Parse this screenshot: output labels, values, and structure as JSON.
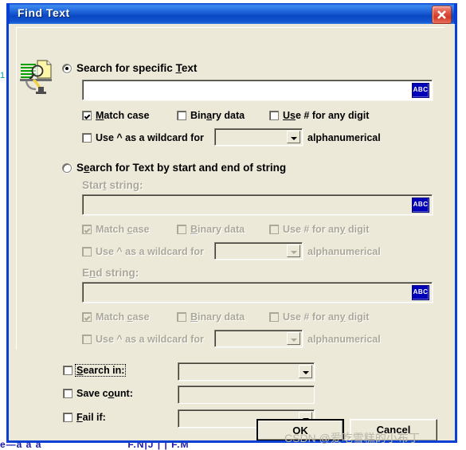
{
  "window": {
    "title": "Find Text",
    "close_icon": "close-icon"
  },
  "icon": {
    "name": "find-text-icon"
  },
  "specific": {
    "radio_label_pre": "Search for specific ",
    "radio_label_accel": "T",
    "radio_label_post": "ext",
    "radio_checked": true,
    "text_value": "",
    "abc_button_label": "ABC",
    "options": [
      {
        "pre": "",
        "accel": "M",
        "post": "atch case",
        "checked": true
      },
      {
        "pre": "Bin",
        "accel": "a",
        "post": "ry data",
        "checked": false
      },
      {
        "pre": "",
        "accel": "Us",
        "post": "e # for any digit",
        "checked": false
      }
    ],
    "wildcard": {
      "pre": "Use ^ as a wildcard for ",
      "checked": false,
      "combo_value": "",
      "suffix": "alphanumerical"
    }
  },
  "startend": {
    "radio_label_pre": "S",
    "radio_label_accel": "e",
    "radio_label_post": "arch for Text by start and end of string",
    "radio_checked": false,
    "start_label_pre": "Star",
    "start_label_accel": "t",
    "start_label_post": " string:",
    "start_value": "",
    "end_label_pre": "E",
    "end_label_accel": "n",
    "end_label_post": "d string:",
    "end_value": "",
    "abc_button_label": "ABC",
    "start_options": [
      {
        "pre": "Match ",
        "accel": "c",
        "post": "ase",
        "checked": true
      },
      {
        "pre": "",
        "accel": "B",
        "post": "inary data",
        "checked": false
      },
      {
        "pre": "Use # for an",
        "accel": "y",
        "post": " digit",
        "checked": false
      }
    ],
    "start_wildcard": {
      "pre": "Use ^ as a wildcard for ",
      "checked": false,
      "combo_value": "",
      "suffix": "alphanumerical"
    },
    "end_options": [
      {
        "pre": "Match ",
        "accel": "c",
        "post": "ase",
        "checked": true
      },
      {
        "pre": "",
        "accel": "B",
        "post": "inary data",
        "checked": false
      },
      {
        "pre": "Use # for an",
        "accel": "y",
        "post": " digit",
        "checked": false
      }
    ],
    "end_wildcard": {
      "pre": "Use ^ as a wildcard for ",
      "checked": false,
      "combo_value": "",
      "suffix": "alphanumerical"
    }
  },
  "bottom": {
    "rows": [
      {
        "pre": "",
        "accel": "S",
        "post": "earch in:",
        "checked": false,
        "control": "combo",
        "value": "",
        "focused": true
      },
      {
        "pre": "Save c",
        "accel": "o",
        "post": "unt:",
        "checked": false,
        "control": "text",
        "value": "",
        "focused": false
      },
      {
        "pre": "",
        "accel": "F",
        "post": "ail if:",
        "checked": false,
        "control": "combo",
        "value": "",
        "focused": false
      }
    ]
  },
  "buttons": {
    "ok": "OK",
    "cancel": "Cancel"
  },
  "background": {
    "left_mark": "1",
    "bottom_text_1": "e—ā ā ā",
    "bottom_text_2": "F.N|J | | F.M",
    "watermark": "CSDN @爱吃雪糕的小布丁"
  },
  "colors": {
    "title_blue": "#0a3fd4",
    "face": "#ece9d8",
    "disabled_text": "#aca899",
    "field_white": "#ffffff",
    "abc_blue": "#0000b8"
  }
}
